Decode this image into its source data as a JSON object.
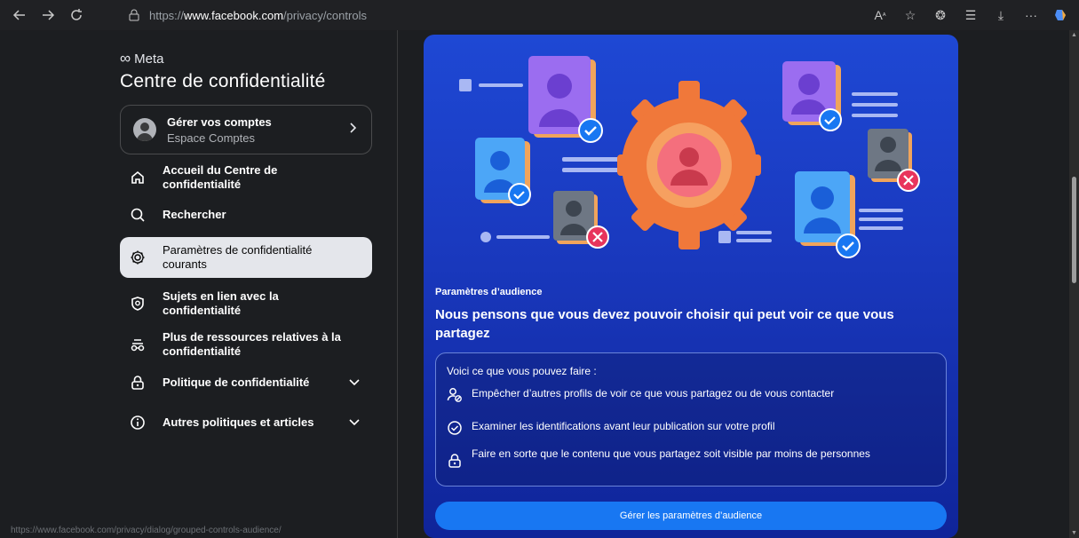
{
  "browser": {
    "url_prefix": "https://",
    "url_domain": "www.facebook.com",
    "url_path": "/privacy/controls"
  },
  "sidebar": {
    "brand": "Meta",
    "title": "Centre de confidentialité",
    "account": {
      "title": "Gérer vos comptes",
      "subtitle": "Espace Comptes"
    },
    "items": [
      {
        "label": "Accueil du Centre de confidentialité",
        "icon": "home-icon"
      },
      {
        "label": "Rechercher",
        "icon": "search-icon"
      },
      {
        "label": "Paramètres de confidentialité courants",
        "icon": "gear-icon",
        "active": true
      },
      {
        "label": "Sujets en lien avec la confidentialité",
        "icon": "shield-icon"
      },
      {
        "label": "Plus de ressources relatives à la confidentialité",
        "icon": "resources-icon"
      },
      {
        "label": "Politique de confidentialité",
        "icon": "lock-icon",
        "expandable": true
      },
      {
        "label": "Autres politiques et articles",
        "icon": "info-icon",
        "expandable": true
      }
    ]
  },
  "card": {
    "section_label": "Paramètres d’audience",
    "headline": "Nous pensons que vous devez pouvoir choisir qui peut voir ce que vous partagez",
    "box_title": "Voici ce que vous pouvez faire :",
    "rows": [
      {
        "text": "Empêcher d’autres profils de voir ce que vous partagez ou de vous contacter",
        "icon": "block-user-icon"
      },
      {
        "text": "Examiner les identifications avant leur publication sur votre profil",
        "icon": "check-circle-icon"
      },
      {
        "text": "Faire en sorte que le contenu que vous partagez soit visible par moins de personnes",
        "icon": "lock-icon"
      }
    ],
    "cta_label": "Gérer les paramètres d’audience"
  },
  "status_url": "https://www.facebook.com/privacy/dialog/grouped-controls-audience/",
  "colors": {
    "accent": "#1877f2",
    "card_bg": "#1a3ac0",
    "gear": "#f0783a",
    "check": "#1877f2",
    "cross": "#e8345c"
  }
}
